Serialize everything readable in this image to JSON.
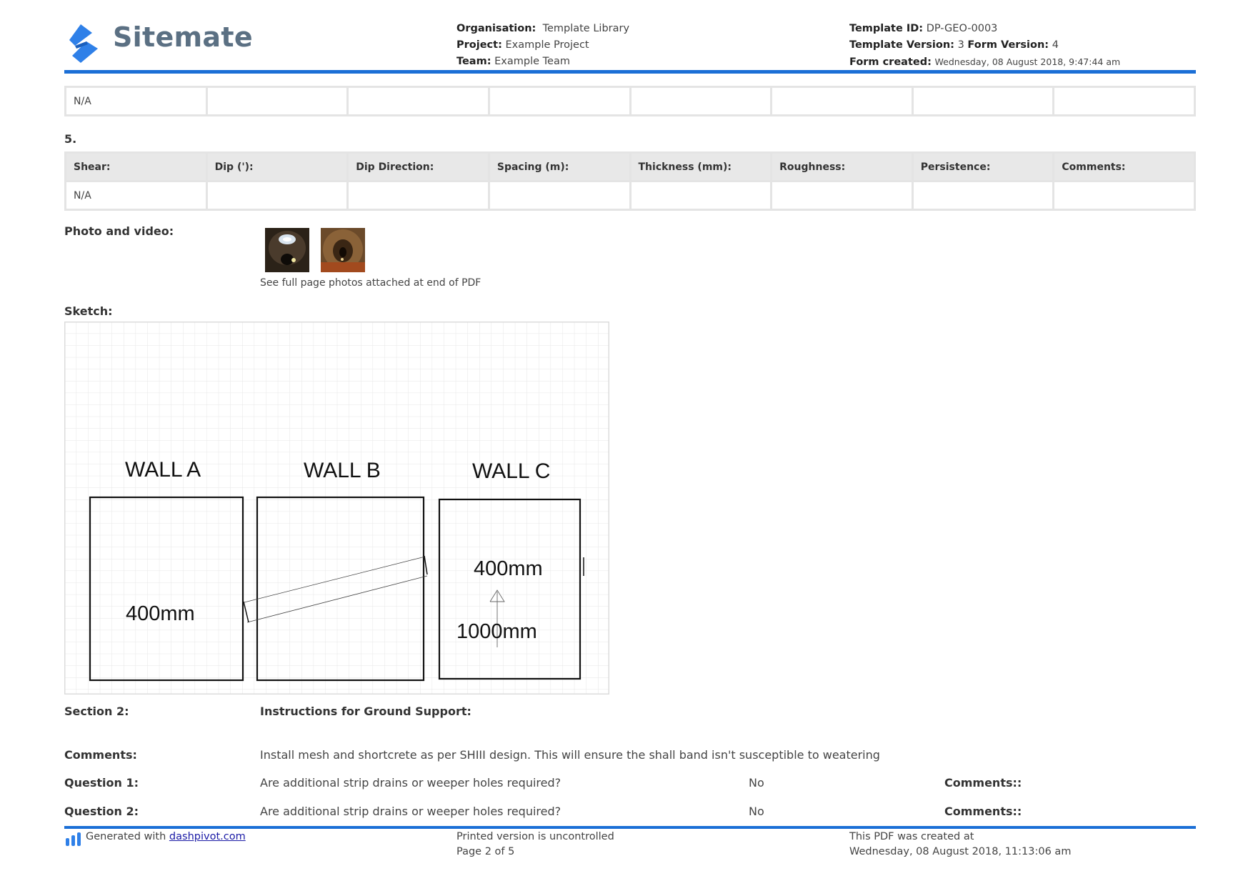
{
  "header": {
    "brand": "Sitemate",
    "organisation_label": "Organisation:",
    "organisation": "Template Library",
    "project_label": "Project:",
    "project": "Example Project",
    "team_label": "Team:",
    "team": "Example Team",
    "template_id_label": "Template ID:",
    "template_id": "DP-GEO-0003",
    "template_version_label": "Template Version:",
    "template_version": "3",
    "form_version_label": "Form Version:",
    "form_version": "4",
    "form_created_label": "Form created:",
    "form_created": "Wednesday, 08 August 2018, 9:47:44 am",
    "accent_color": "#1b6fd6"
  },
  "top_table": {
    "row": [
      "N/A",
      "",
      "",
      "",
      "",
      "",
      "",
      ""
    ]
  },
  "section5": {
    "number": "5.",
    "columns": [
      "Shear:",
      "Dip ('):",
      "Dip Direction:",
      "Spacing (m):",
      "Thickness (mm):",
      "Roughness:",
      "Persistence:",
      "Comments:"
    ],
    "row": [
      "N/A",
      "",
      "",
      "",
      "",
      "",
      "",
      ""
    ]
  },
  "photo": {
    "label": "Photo and video:",
    "note": "See full page photos attached at end of PDF"
  },
  "sketch": {
    "label": "Sketch:",
    "wall_a": "WALL A",
    "wall_b": "WALL B",
    "wall_c": "WALL C",
    "dim_a": "400mm",
    "dim_c1": "400mm",
    "dim_c2": "1000mm"
  },
  "section2": {
    "label": "Section 2:",
    "title": "Instructions for Ground Support:",
    "comments_label": "Comments:",
    "comments": "Install mesh and shortcrete as per SHIII design. This will ensure the shall band isn't susceptible to weatering",
    "questions": [
      {
        "label": "Question 1:",
        "text": "Are additional strip drains or weeper holes required?",
        "answer": "No",
        "comments_label": "Comments::"
      },
      {
        "label": "Question 2:",
        "text": "Are additional strip drains or weeper holes required?",
        "answer": "No",
        "comments_label": "Comments::"
      }
    ]
  },
  "footer": {
    "generated": "Generated with",
    "link": "dashpivot.com",
    "printed": "Printed version is uncontrolled",
    "page": "Page 2 of 5",
    "created_label": "This PDF was created at",
    "created": "Wednesday, 08 August 2018, 11:13:06 am"
  }
}
